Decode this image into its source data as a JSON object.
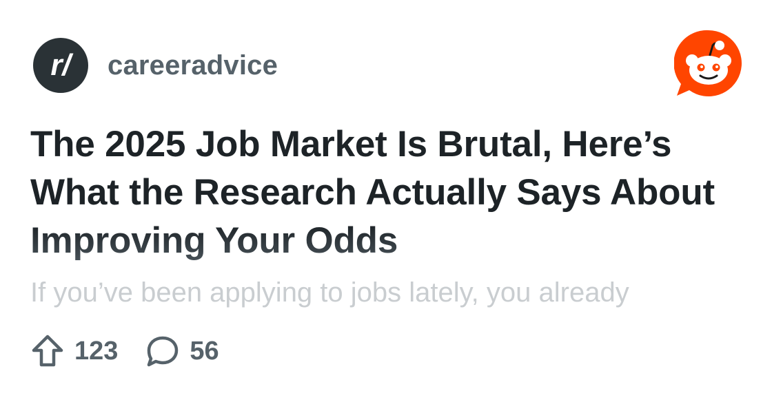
{
  "subreddit": {
    "name": "careeradvice",
    "avatar_text": "r/",
    "avatar_icon": "subreddit-avatar-icon"
  },
  "brand": {
    "logo_icon": "reddit-snoo-icon",
    "accent": "#ff4500"
  },
  "post": {
    "title": "The 2025 Job Market Is Brutal, Here’s What the Research Actually Says About Improving Your Odds",
    "preview": "If you’ve been applying to jobs lately, you already"
  },
  "stats": {
    "upvotes": "123",
    "comments": "56",
    "upvote_icon": "upvote-arrow-icon",
    "comment_icon": "comment-bubble-icon"
  },
  "colors": {
    "text_dark": "#1d2327",
    "text_muted": "#56626a",
    "preview_text": "#c9cdd0",
    "avatar_bg": "#2a3236"
  }
}
